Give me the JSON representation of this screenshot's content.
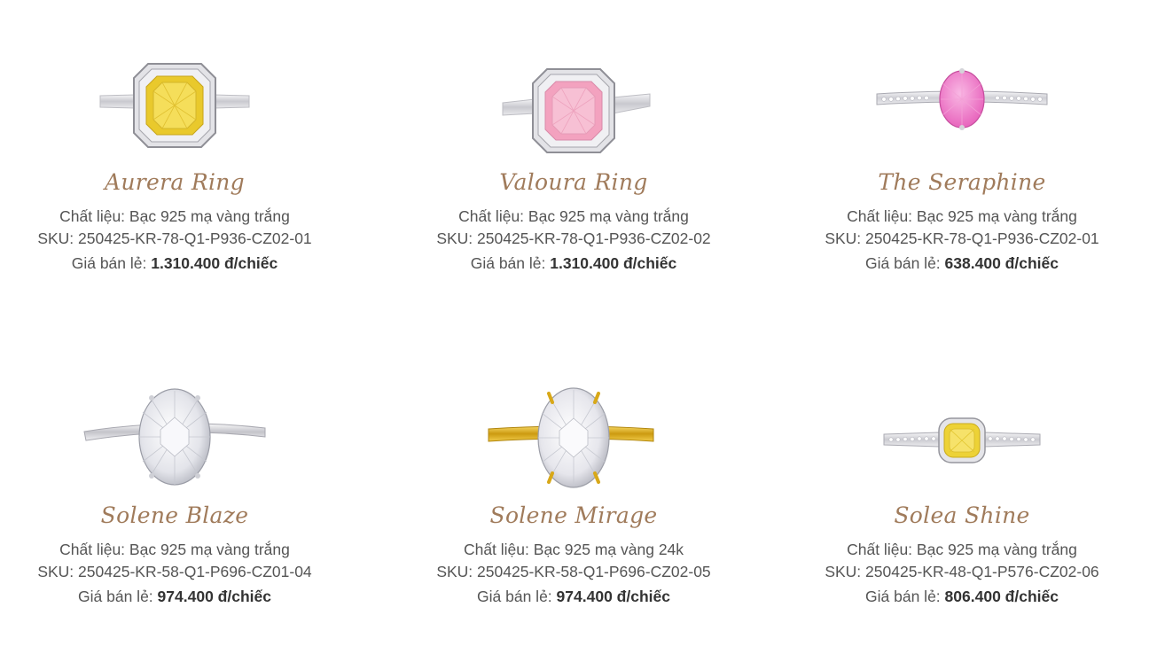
{
  "products": [
    {
      "name": "Aurera Ring",
      "material_label": "Chất liệu:",
      "material": "Bạc 925 mạ vàng trắng",
      "sku_label": "SKU:",
      "sku": "250425-KR-78-Q1-P936-CZ02-01",
      "price_label": "Giá bán lẻ:",
      "price": "1.310.400 đ/chiếc",
      "stone_color": "#f1d23a",
      "band_color": "#d9d9dc",
      "image": "yellow-cushion-halo-ring-icon"
    },
    {
      "name": "Valoura Ring",
      "material_label": "Chất liệu:",
      "material": "Bạc 925 mạ vàng trắng",
      "sku_label": "SKU:",
      "sku": "250425-KR-78-Q1-P936-CZ02-02",
      "price_label": "Giá bán lẻ:",
      "price": "1.310.400 đ/chiếc",
      "stone_color": "#f3a9c4",
      "band_color": "#d9d9dc",
      "image": "pink-cushion-halo-ring-icon"
    },
    {
      "name": "The Seraphine",
      "material_label": "Chất liệu:",
      "material": "Bạc 925 mạ vàng trắng",
      "sku_label": "SKU:",
      "sku": "250425-KR-78-Q1-P936-CZ02-01",
      "price_label": "Giá bán lẻ:",
      "price": "638.400 đ/chiếc",
      "stone_color": "#ee7dc7",
      "band_color": "#d9d9dc",
      "image": "pink-oval-pave-ring-icon"
    },
    {
      "name": "Solene Blaze",
      "material_label": "Chất liệu:",
      "material": "Bạc 925 mạ vàng trắng",
      "sku_label": "SKU:",
      "sku": "250425-KR-58-Q1-P696-CZ01-04",
      "price_label": "Giá bán lẻ:",
      "price": "974.400 đ/chiếc",
      "stone_color": "#f4f5f8",
      "band_color": "#d9d9dc",
      "image": "clear-oval-solitaire-ring-icon"
    },
    {
      "name": "Solene Mirage",
      "material_label": "Chất liệu:",
      "material": "Bạc 925 mạ vàng 24k",
      "sku_label": "SKU:",
      "sku": "250425-KR-58-Q1-P696-CZ02-05",
      "price_label": "Giá bán lẻ:",
      "price": "974.400 đ/chiếc",
      "stone_color": "#f1f1f4",
      "band_color": "#e2b21e",
      "image": "clear-oval-gold-solitaire-ring-icon"
    },
    {
      "name": "Solea Shine",
      "material_label": "Chất liệu:",
      "material": "Bạc 925 mạ vàng trắng",
      "sku_label": "SKU:",
      "sku": "250425-KR-48-Q1-P576-CZ02-06",
      "price_label": "Giá bán lẻ:",
      "price": "806.400 đ/chiếc",
      "stone_color": "#f0d63e",
      "band_color": "#d9d9dc",
      "image": "yellow-cushion-pave-ring-icon"
    }
  ]
}
